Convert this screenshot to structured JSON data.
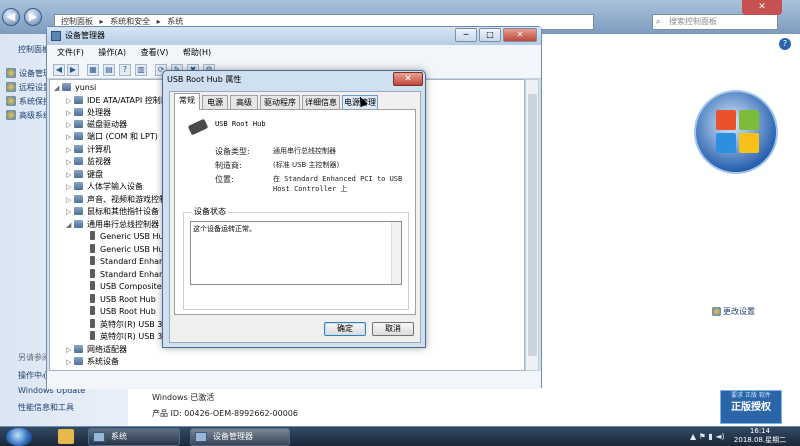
{
  "system_window": {
    "address_parts": [
      "控制面板",
      "▸",
      "系统和安全",
      "▸",
      "系统"
    ],
    "search_placeholder": "搜索控制面板",
    "close_label": "✕",
    "help_label": "?",
    "sidebar": {
      "home": "控制面板主页",
      "items": [
        "设备管理器",
        "远程设置",
        "系统保护",
        "高级系统设置"
      ],
      "see_also": "另请参阅",
      "links": [
        "操作中心",
        "Windows Update",
        "性能信息和工具"
      ]
    },
    "change_settings": "更改设置",
    "activation": "Windows 已激活",
    "product_id": "产品 ID: 00426-OEM-8992662-00006",
    "genuine": {
      "line1": "要求 正版 软件",
      "line2": "正版授权"
    }
  },
  "device_manager": {
    "title": "设备管理器",
    "controls": [
      "─",
      "□",
      "✕"
    ],
    "menu": [
      "文件(F)",
      "操作(A)",
      "查看(V)",
      "帮助(H)"
    ],
    "toolbar": [
      "◀",
      "▶",
      "▦",
      "▤",
      "?",
      "▥",
      "⟳",
      "✎",
      "✖",
      "⚙"
    ],
    "tree": {
      "root": "yunsi",
      "categories": [
        "IDE ATA/ATAPI 控制器",
        "处理器",
        "磁盘驱动器",
        "端口 (COM 和 LPT)",
        "计算机",
        "监视器",
        "键盘",
        "人体学输入设备",
        "声音、视频和游戏控制器",
        "鼠标和其他指针设备",
        "通用串行总线控制器"
      ],
      "usb_children": [
        "Generic USB Hu",
        "Generic USB Hu",
        "Standard Enhan",
        "Standard Enhan",
        "USB Composite",
        "USB Root Hub",
        "USB Root Hub",
        "英特尔(R) USB 3.",
        "英特尔(R) USB 3."
      ],
      "after": [
        "网络适配器",
        "系统设备"
      ]
    }
  },
  "dialog": {
    "title": "USB Root Hub 属性",
    "close_label": "✕",
    "tabs": [
      "常规",
      "电源",
      "高级",
      "驱动程序",
      "详细信息",
      "电源管理"
    ],
    "active_tab": "常规",
    "device_name": "USB Root Hub",
    "device_type_label": "设备类型:",
    "device_type_value": "通用串行总线控制器",
    "manufacturer_label": "制造商:",
    "manufacturer_value": "(标准 USB 主控制器)",
    "location_label": "位置:",
    "location_value": "在 Standard Enhanced PCI to USB Host Controller 上",
    "status_group": "设备状态",
    "status_text": "这个设备运转正常。",
    "ok_label": "确定",
    "cancel_label": "取消"
  },
  "taskbar": {
    "buttons": [
      "系统",
      "设备管理器"
    ],
    "tray": "▲ ⚑ ▮ ◄)",
    "time": "16:14",
    "date": "2018.08.星期二"
  },
  "colors": {
    "accent": "#2c63b0",
    "title_close": "#c0463a",
    "taskbar": "#1a2738"
  }
}
